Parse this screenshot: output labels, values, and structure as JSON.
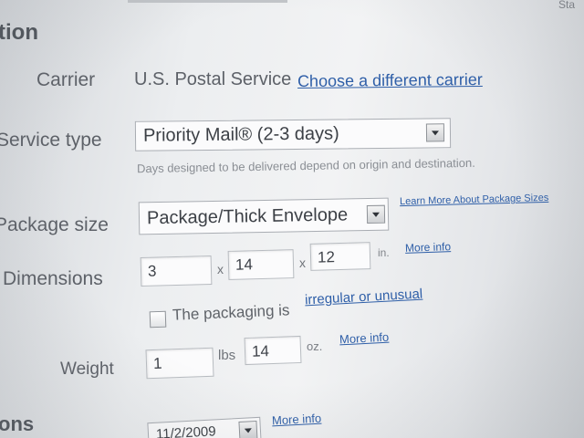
{
  "corner_text": "Sta",
  "section_heading": "tion",
  "carrier": {
    "label": "Carrier",
    "value": "U.S. Postal Service",
    "change_link": "Choose a different carrier"
  },
  "service_type": {
    "label": "Service type",
    "selected": "Priority Mail® (2-3 days)",
    "hint": "Days designed to be delivered depend on origin and destination."
  },
  "package_size": {
    "label": "Package size",
    "selected": "Package/Thick Envelope",
    "learn_more_link": "Learn More About Package Sizes"
  },
  "dimensions": {
    "label": "Dimensions",
    "length": "3",
    "width": "14",
    "height": "12",
    "separator": "x",
    "unit": "in.",
    "more_info_link": "More info"
  },
  "packaging": {
    "checked": false,
    "text": "The packaging is",
    "link": "irregular or unusual"
  },
  "weight": {
    "label": "Weight",
    "lbs_value": "1",
    "lbs_unit": "lbs",
    "oz_value": "14",
    "oz_unit": "oz.",
    "more_info_link": "More info"
  },
  "options": {
    "heading": "ons",
    "date_value": "11/2/2009",
    "more_info_link": "More info"
  },
  "colors": {
    "link": "#2f5fa8",
    "label": "#5d6168",
    "background": "#eceef0"
  }
}
